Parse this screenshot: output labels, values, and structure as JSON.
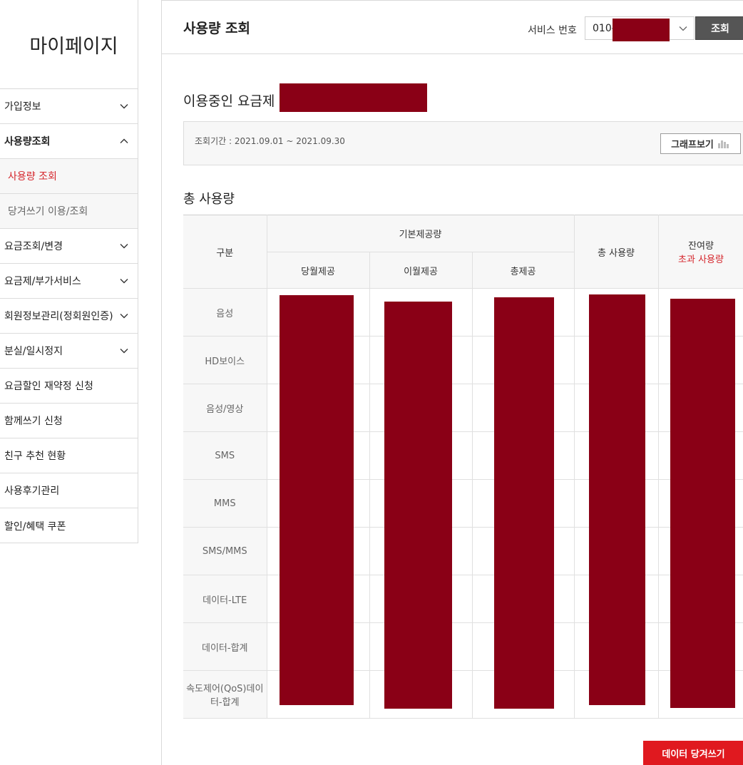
{
  "sidebar": {
    "title": "마이페이지",
    "items": [
      {
        "label": "가입정보",
        "chevron": "down"
      },
      {
        "label": "사용량조회",
        "chevron": "up",
        "active": true,
        "sub": [
          {
            "label": "사용량 조회",
            "current": true
          },
          {
            "label": "당겨쓰기 이용/조회",
            "current": false
          }
        ]
      },
      {
        "label": "요금조회/변경",
        "chevron": "down"
      },
      {
        "label": "요금제/부가서비스",
        "chevron": "down"
      },
      {
        "label": "회원정보관리(정회원인증)",
        "chevron": "down"
      },
      {
        "label": "분실/일시정지",
        "chevron": "down"
      },
      {
        "label": "요금할인 재약정 신청"
      },
      {
        "label": "함께쓰기 신청"
      },
      {
        "label": "친구 추천 현황"
      },
      {
        "label": "사용후기관리"
      },
      {
        "label": "할인/혜택 쿠폰"
      }
    ]
  },
  "header": {
    "title": "사용량 조회",
    "service_label": "서비스 번호",
    "service_value": "010-",
    "query_button": "조회"
  },
  "plan": {
    "label": "이용중인 요금제 :",
    "period": "조회기간 : 2021.09.01 ~ 2021.09.30",
    "graph_button": "그래프보기"
  },
  "usage": {
    "section_title": "총 사용량",
    "headers": {
      "category": "구분",
      "base": "기본제공량",
      "this_month": "당월제공",
      "carry_over": "이월제공",
      "total_provided": "총제공",
      "total_used": "총 사용량",
      "remaining": "잔여량",
      "overage": "초과 사용량"
    },
    "rows": [
      "음성",
      "HD보이스",
      "음성/영상",
      "SMS",
      "MMS",
      "SMS/MMS",
      "데이터-LTE",
      "데이터-합계",
      "속도제어(QoS)데이터-합계"
    ]
  },
  "footer": {
    "pull_button": "데이터 당겨쓰기"
  },
  "colors": {
    "accent_red": "#d5262c",
    "button_red": "#e0191f",
    "redaction": "#8a0016",
    "dark_button": "#555555"
  },
  "icons": {
    "chevron_down": "chevron-down-icon",
    "chevron_up": "chevron-up-icon",
    "graph": "bar-chart-icon"
  }
}
